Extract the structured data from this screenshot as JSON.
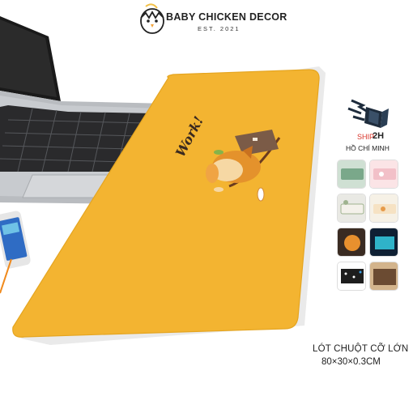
{
  "brand": {
    "name": "BABY CHICKEN DECOR",
    "established": "EST. 2021"
  },
  "mousepad": {
    "artwork_text": "Work!",
    "pad_color": "#f2b535"
  },
  "shipping": {
    "label": "SHIP",
    "time": "2H",
    "city": "HỒ CHÍ MINH",
    "icon": "fast-delivery-icon"
  },
  "product": {
    "name": "LÓT CHUỘT CỠ LỚN",
    "size": "80×30×0.3CM"
  },
  "variants": [
    {
      "name": "thumb-green-desk",
      "colors": [
        "#7aa88a",
        "#cfe0d3"
      ]
    },
    {
      "name": "thumb-pink",
      "colors": [
        "#f2c0c8",
        "#fbe4e6"
      ]
    },
    {
      "name": "thumb-white-desk",
      "colors": [
        "#e9e9e4",
        "#9fb38f"
      ]
    },
    {
      "name": "thumb-animals",
      "colors": [
        "#f6f1e6",
        "#e69b4a"
      ]
    },
    {
      "name": "thumb-orange-scene",
      "colors": [
        "#3a2b22",
        "#e8902e"
      ]
    },
    {
      "name": "thumb-neon",
      "colors": [
        "#0f2034",
        "#2fb3c9"
      ]
    },
    {
      "name": "thumb-black-dots",
      "colors": [
        "#1d1d1d",
        "#ffffff"
      ]
    },
    {
      "name": "thumb-brown",
      "colors": [
        "#6b4b32",
        "#d3b48c"
      ]
    }
  ]
}
